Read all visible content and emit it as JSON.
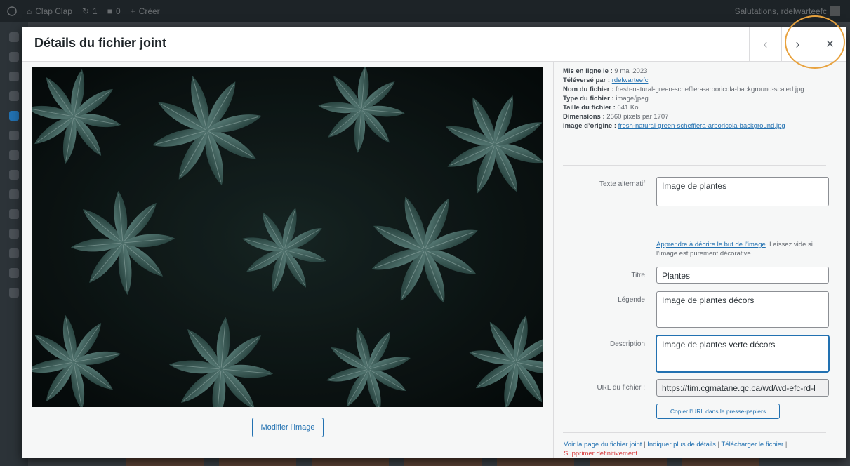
{
  "adminbar": {
    "site_name": "Clap Clap",
    "updates_count": "1",
    "comments_count": "0",
    "new_label": "Créer",
    "greeting": "Salutations, rdelwarteefc"
  },
  "modal": {
    "title": "Détails du fichier joint",
    "prev_icon": "‹",
    "next_icon": "›",
    "close_icon": "×",
    "edit_image_label": "Modifier l’image"
  },
  "details": {
    "uploaded_on_label": "Mis en ligne le :",
    "uploaded_on_value": "9 mai 2023",
    "uploaded_by_label": "Téléversé par :",
    "uploaded_by_value": "rdelwarteefc",
    "filename_label": "Nom du fichier :",
    "filename_value": "fresh-natural-green-schefflera-arboricola-background-scaled.jpg",
    "filetype_label": "Type du fichier :",
    "filetype_value": "image/jpeg",
    "filesize_label": "Taille du fichier :",
    "filesize_value": "641 Ko",
    "dimensions_label": "Dimensions :",
    "dimensions_value": "2560 pixels par 1707",
    "original_label": "Image d’origine :",
    "original_value": "fresh-natural-green-schefflera-arboricola-background.jpg"
  },
  "form": {
    "alt_label": "Texte alternatif",
    "alt_value": "Image de plantes",
    "alt_help_link": "Apprendre à décrire le but de l’image",
    "alt_help_text": ". Laissez vide si l’image est purement décorative.",
    "title_label": "Titre",
    "title_value": "Plantes",
    "caption_label": "Légende",
    "caption_value": "Image de plantes décors",
    "description_label": "Description",
    "description_value": "Image de plantes verte décors",
    "url_label": "URL du fichier :",
    "url_value": "https://tim.cgmatane.qc.ca/wd/wd-efc-rd-l",
    "copy_button": "Copier l’URL dans le presse-papiers"
  },
  "actions": {
    "view_page": "Voir la page du fichier joint",
    "more_details": "Indiquer plus de détails",
    "download": "Télécharger le fichier",
    "delete": "Supprimer définitivement",
    "separator": " | "
  },
  "colors": {
    "link": "#2271b1",
    "delete": "#d63638",
    "highlight_ring": "#e8a23e",
    "image_dark": "#0e1716",
    "leaf": "#3f6b66"
  }
}
